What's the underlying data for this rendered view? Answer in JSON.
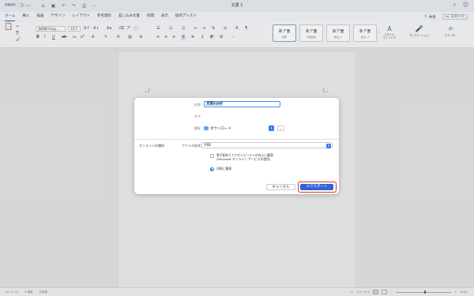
{
  "titlebar": {
    "autosave_label": "自動保存",
    "autosave_state": "オフ",
    "title": "文書 1",
    "icons": [
      "home-icon",
      "save-icon",
      "undo-icon",
      "redo-icon",
      "print-icon",
      "more-icon"
    ],
    "right_icons": [
      "search-icon",
      "account-icon"
    ]
  },
  "tabs": {
    "items": [
      "ホーム",
      "挿入",
      "描画",
      "デザイン",
      "レイアウト",
      "参考資料",
      "差し込み文書",
      "校閲",
      "表示",
      "操作アシスト"
    ],
    "active": 0,
    "share_label": "共有",
    "comment_label": "コメント"
  },
  "ribbon": {
    "font_name": "游明朝 Regu...",
    "font_size": "10.5",
    "styles": [
      {
        "sample": "あア亜",
        "name": "標準"
      },
      {
        "sample": "あア亜",
        "name": "行間詰め"
      },
      {
        "sample": "あア亜",
        "name": "見出し1"
      },
      {
        "sample": "あア亜",
        "name": "見出し2"
      }
    ],
    "style_pane_label": "スタイル\nウィンドウ",
    "dictation_label": "ディクテーション",
    "editor_label": "エディター"
  },
  "dialog": {
    "name_label": "名前:",
    "name_value": "文書1.pdf",
    "tags_label": "タグ:",
    "where_label": "場所:",
    "where_value": "ダウンロード",
    "online_label": "オンラインの場所",
    "format_label": "ファイル形式:",
    "format_value": "PDF",
    "option1": "電子配布とアクセシビリティの向上に最適",
    "option1b": "(Microsoft オンライン サービスを使用)",
    "option2": "印刷に最適",
    "cancel_label": "キャンセル",
    "export_label": "エクスポート"
  },
  "statusbar": {
    "page": "1/1 ページ",
    "words": "0 単語",
    "lang": "日本語",
    "focus": "フォーカス",
    "zoom": "100%"
  }
}
